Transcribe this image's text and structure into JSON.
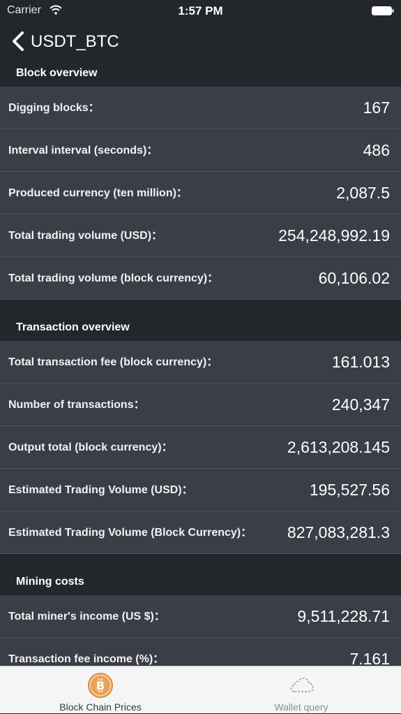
{
  "status": {
    "carrier": "Carrier",
    "time": "1:57 PM"
  },
  "nav": {
    "title": "USDT_BTC"
  },
  "sections": {
    "block_overview": {
      "header": "Block overview",
      "rows": [
        {
          "label": "Digging blocks：",
          "value": "167"
        },
        {
          "label": "Interval interval (seconds)：",
          "value": "486"
        },
        {
          "label": "Produced currency (ten million)：",
          "value": "2,087.5"
        },
        {
          "label": "Total trading volume (USD)：",
          "value": "254,248,992.19"
        },
        {
          "label": "Total trading volume (block currency)：",
          "value": "60,106.02"
        }
      ]
    },
    "transaction_overview": {
      "header": "Transaction overview",
      "rows": [
        {
          "label": "Total transaction fee (block currency)：",
          "value": "161.013"
        },
        {
          "label": "Number of transactions：",
          "value": "240,347"
        },
        {
          "label": "Output total (block currency)：",
          "value": "2,613,208.145"
        },
        {
          "label": "Estimated Trading Volume (USD)：",
          "value": "195,527.56"
        },
        {
          "label": "Estimated Trading Volume (Block Currency)：",
          "value": "827,083,281.3"
        }
      ]
    },
    "mining_costs": {
      "header": "Mining costs",
      "rows": [
        {
          "label": "Total miner's income (US $)：",
          "value": "9,511,228.71"
        },
        {
          "label": "Transaction fee income (%)：",
          "value": "7.161"
        }
      ]
    }
  },
  "tabs": [
    {
      "label": "Block Chain Prices",
      "icon": "bitcoin-coin-icon",
      "selected": true
    },
    {
      "label": "Wallet query",
      "icon": "cloud-icon",
      "selected": false
    }
  ],
  "colors": {
    "background": "#23262b",
    "row": "#3a3e47",
    "accent": "#d98c3e",
    "tabbar": "#f5f5f6"
  }
}
